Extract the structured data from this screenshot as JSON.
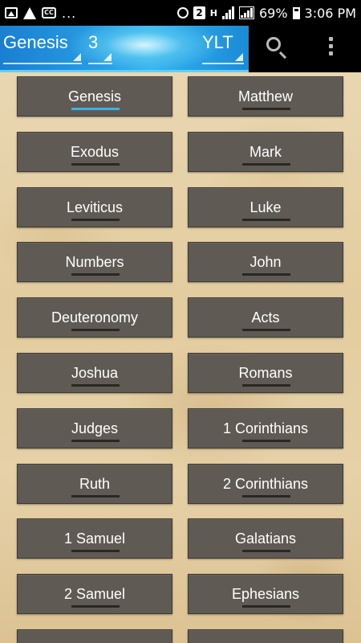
{
  "status_bar": {
    "dots": "...",
    "badge": "2",
    "network": "H",
    "battery_pct": "69%",
    "time": "3:06 PM"
  },
  "toolbar": {
    "book": "Genesis",
    "chapter": "3",
    "version": "YLT",
    "search_icon": "search-icon",
    "more_icon": "overflow-menu-icon"
  },
  "books": {
    "old_testament": [
      "Genesis",
      "Exodus",
      "Leviticus",
      "Numbers",
      "Deuteronomy",
      "Joshua",
      "Judges",
      "Ruth",
      "1 Samuel",
      "2 Samuel",
      ""
    ],
    "new_testament": [
      "Matthew",
      "Mark",
      "Luke",
      "John",
      "Acts",
      "Romans",
      "1 Corinthians",
      "2 Corinthians",
      "Galatians",
      "Ephesians",
      ""
    ],
    "selected": "Genesis"
  },
  "colors": {
    "selected_underline": "#3fb2e6",
    "button_bg": "#5f5b54",
    "header_accent": "#36b4f0"
  }
}
